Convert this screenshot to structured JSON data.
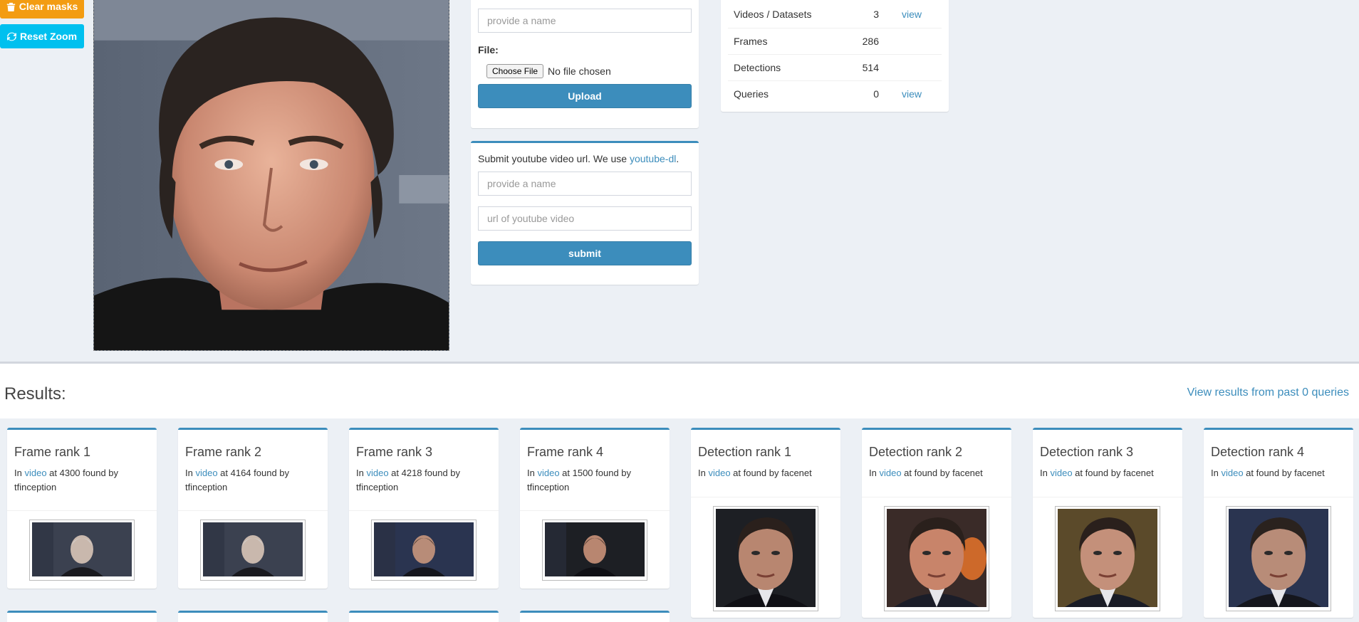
{
  "sidebar_actions": {
    "clear_masks_label": "Clear masks",
    "reset_zoom_label": "Reset Zoom"
  },
  "upload_panel": {
    "name_placeholder": "provide a name",
    "file_label": "File:",
    "choose_file_label": "Choose File",
    "no_file_text": "No file chosen",
    "upload_label": "Upload"
  },
  "youtube_panel": {
    "intro_text": "Submit youtube video url. We use ",
    "intro_link": "youtube-dl",
    "intro_end": ".",
    "name_placeholder": "provide a name",
    "url_placeholder": "url of youtube video",
    "submit_label": "submit"
  },
  "stats": [
    {
      "label": "Videos / Datasets",
      "value": "3",
      "action": "view"
    },
    {
      "label": "Frames",
      "value": "286",
      "action": ""
    },
    {
      "label": "Detections",
      "value": "514",
      "action": ""
    },
    {
      "label": "Queries",
      "value": "0",
      "action": "view"
    }
  ],
  "results": {
    "title": "Results:",
    "past_link": "View results from past 0 queries",
    "cards": [
      {
        "title": "Frame rank 1",
        "prefix": "In ",
        "link": "video",
        "suffix": " at 4300 found by tfinception",
        "kind": "frame",
        "palette": "grey"
      },
      {
        "title": "Frame rank 2",
        "prefix": "In ",
        "link": "video",
        "suffix": " at 4164 found by tfinception",
        "kind": "frame",
        "palette": "grey"
      },
      {
        "title": "Frame rank 3",
        "prefix": "In ",
        "link": "video",
        "suffix": " at 4218 found by tfinception",
        "kind": "frame",
        "palette": "blue"
      },
      {
        "title": "Frame rank 4",
        "prefix": "In ",
        "link": "video",
        "suffix": " at 1500 found by tfinception",
        "kind": "frame",
        "palette": "dark"
      },
      {
        "title": "Detection rank 1",
        "prefix": "In ",
        "link": "video",
        "suffix": " at found by facenet",
        "kind": "detection",
        "palette": "dark"
      },
      {
        "title": "Detection rank 2",
        "prefix": "In ",
        "link": "video",
        "suffix": " at found by facenet",
        "kind": "detection",
        "palette": "fire"
      },
      {
        "title": "Detection rank 3",
        "prefix": "In ",
        "link": "video",
        "suffix": " at found by facenet",
        "kind": "detection",
        "palette": "warm"
      },
      {
        "title": "Detection rank 4",
        "prefix": "In ",
        "link": "video",
        "suffix": " at found by facenet",
        "kind": "detection",
        "palette": "blue"
      }
    ]
  },
  "colors": {
    "primary": "#3c8dbc",
    "warning": "#f39c12",
    "info": "#00c0ef",
    "background": "#ecf0f5"
  }
}
